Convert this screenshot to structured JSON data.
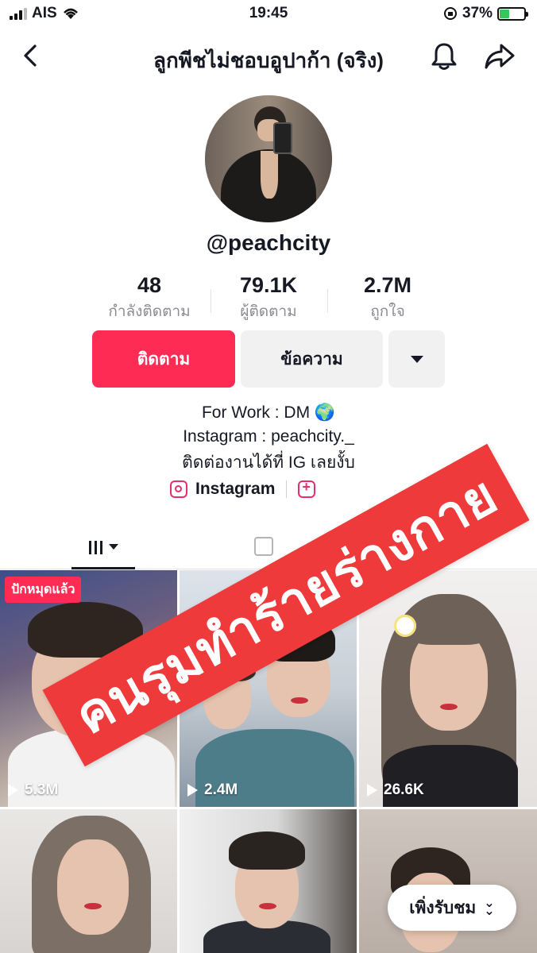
{
  "status_bar": {
    "carrier": "AIS",
    "time": "19:45",
    "battery": "37%"
  },
  "header": {
    "title": "ลูกพีชไม่ชอบอูปาก้า (จริง)"
  },
  "profile": {
    "username": "@peachcity"
  },
  "stats": [
    {
      "value": "48",
      "label": "กำลังติดตาม"
    },
    {
      "value": "79.1K",
      "label": "ผู้ติดตาม"
    },
    {
      "value": "2.7M",
      "label": "ถูกใจ"
    }
  ],
  "actions": {
    "follow": "ติดตาม",
    "message": "ข้อความ"
  },
  "bio": [
    "For Work : DM 🌍",
    "Instagram : peachcity._",
    "ติดต่องานได้ที่ IG เลยงั้บ"
  ],
  "links": {
    "instagram": "Instagram"
  },
  "videos": [
    {
      "views": "5.3M",
      "badge": "ปักหมุดแล้ว"
    },
    {
      "views": "2.4M"
    },
    {
      "views": "26.6K"
    },
    {},
    {},
    {}
  ],
  "recent_pill": {
    "label": "เพิ่งรับชม"
  },
  "overlay": {
    "text": "คนรุมทำร้ายร่างกาย",
    "color": "#ee3a3a"
  },
  "colors": {
    "accent": "#fe2c55",
    "instagram": "#e1306c"
  }
}
